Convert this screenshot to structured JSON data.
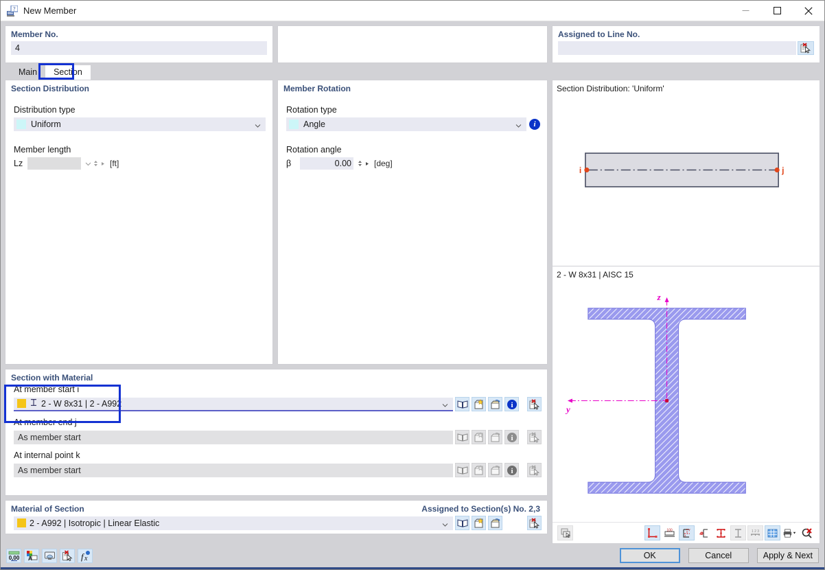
{
  "window": {
    "title": "New Member",
    "icon": "new-member-icon",
    "minimize": "minimize-icon",
    "maximize": "maximize-icon",
    "close": "close-icon"
  },
  "top": {
    "member_no": {
      "label": "Member No.",
      "value": "4"
    },
    "middle": {
      "label": "",
      "value": ""
    },
    "assigned_line": {
      "label": "Assigned to Line No.",
      "value": "",
      "pick_icon": "select-pick-icon"
    }
  },
  "tabs": [
    {
      "label": "Main",
      "active": false
    },
    {
      "label": "Section",
      "active": true,
      "highlighted": true
    }
  ],
  "section_distribution": {
    "title": "Section Distribution",
    "distribution_type_label": "Distribution type",
    "distribution_type_value": "Uniform",
    "member_length_label": "Member length",
    "length_symbol": "Lz",
    "length_value": "",
    "length_unit": "[ft]"
  },
  "member_rotation": {
    "title": "Member Rotation",
    "rotation_type_label": "Rotation type",
    "rotation_type_value": "Angle",
    "info_icon": "info-icon",
    "rotation_angle_label": "Rotation angle",
    "angle_symbol": "β",
    "angle_value": "0.00",
    "angle_unit": "[deg]"
  },
  "section_with_material": {
    "title": "Section with Material",
    "rows": [
      {
        "label": "At member start i",
        "value": "2 - W 8x31 | 2 - A992",
        "state": "active",
        "color": "#f5c518"
      },
      {
        "label": "At member end j",
        "value": "As member start",
        "state": "readonly"
      },
      {
        "label": "At internal point k",
        "value": "As member start",
        "state": "readonly"
      }
    ],
    "row_icons": [
      "library-icon",
      "new-section-icon",
      "open-section-icon",
      "info-icon",
      "select-pick-icon"
    ]
  },
  "material_of_section": {
    "title": "Material of Section",
    "assigned_label": "Assigned to Section(s) No. 2,3",
    "value": "2 - A992 | Isotropic | Linear Elastic",
    "color": "#f5c518",
    "icons": [
      "library-icon",
      "new-material-icon",
      "open-material-icon",
      "select-pick-icon"
    ]
  },
  "preview": {
    "distribution_caption": "Section Distribution: 'Uniform'",
    "member_start_label": "i",
    "member_end_label": "j",
    "section_caption": "2 - W 8x31 | AISC 15",
    "axis_z": "z",
    "axis_y": "y",
    "colors": {
      "section_fill": "#8f8fe8",
      "axis": "#e800c8",
      "node": "#e2471b",
      "member_fill": "#dcdce2"
    },
    "toolbar_left_icon": "render-mode-icon",
    "toolbar_icons": [
      {
        "name": "dimensions-icon",
        "state": "on"
      },
      {
        "name": "stress-points-icon",
        "state": "flat"
      },
      {
        "name": "axes-icon",
        "state": "on"
      },
      {
        "name": "shear-center-icon",
        "state": "flat"
      },
      {
        "name": "centroid-icon",
        "state": "flat"
      },
      {
        "name": "section-outline-icon",
        "state": "dim"
      },
      {
        "name": "numbering-icon",
        "state": "dim"
      },
      {
        "name": "grid-icon",
        "state": "on"
      },
      {
        "name": "print-icon",
        "state": "flat"
      },
      {
        "name": "zoom-reset-icon",
        "state": "flat"
      }
    ]
  },
  "statusbar": {
    "icons": [
      "number-format-icon",
      "color-legend-icon",
      "display-properties-icon",
      "select-pick-icon",
      "formula-icon"
    ],
    "buttons": [
      {
        "label": "OK",
        "primary": true
      },
      {
        "label": "Cancel",
        "primary": false
      },
      {
        "label": "Apply & Next",
        "primary": false
      }
    ]
  }
}
